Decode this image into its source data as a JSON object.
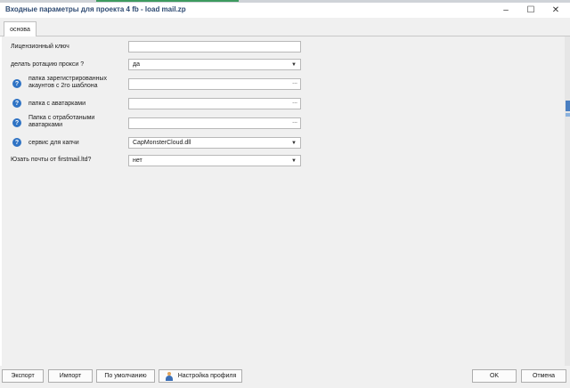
{
  "window": {
    "title": "Входные параметры для проекта 4 fb - load mail.zp",
    "controls": {
      "minimize": "–",
      "maximize": "☐",
      "close": "✕"
    }
  },
  "tabs": [
    {
      "label": "основа"
    }
  ],
  "fields": [
    {
      "label": "Лицензионный ключ",
      "value": "",
      "kind": "text",
      "help": false
    },
    {
      "label": "делать ротацию прокси ?",
      "value": "да",
      "kind": "dropdown",
      "help": false
    },
    {
      "label": "папка зарегистрированных акаунтов с 2го шаблона",
      "value": "",
      "kind": "browse",
      "help": true
    },
    {
      "label": "папка с аватарками",
      "value": "",
      "kind": "browse",
      "help": true
    },
    {
      "label": "Папка с отработаными аватарками",
      "value": "",
      "kind": "browse",
      "help": true
    },
    {
      "label": "сервис для капчи",
      "value": "CapMonsterCloud.dll",
      "kind": "dropdown",
      "help": true
    },
    {
      "label": "Юзать почты от firstmail.ltd?",
      "value": "нет",
      "kind": "dropdown",
      "help": false
    }
  ],
  "glyphs": {
    "help": "?",
    "dropdown_arrow": "▼",
    "browse": "..."
  },
  "buttons": {
    "export": "Экспорт",
    "import": "Импорт",
    "default": "По умолчанию",
    "profile": "Настройка профиля",
    "ok": "OK",
    "cancel": "Отмена"
  },
  "colors": {
    "title_text": "#2f4b73",
    "help_icon": "#2f73c4",
    "accent_strip": "#3d9a5f"
  }
}
